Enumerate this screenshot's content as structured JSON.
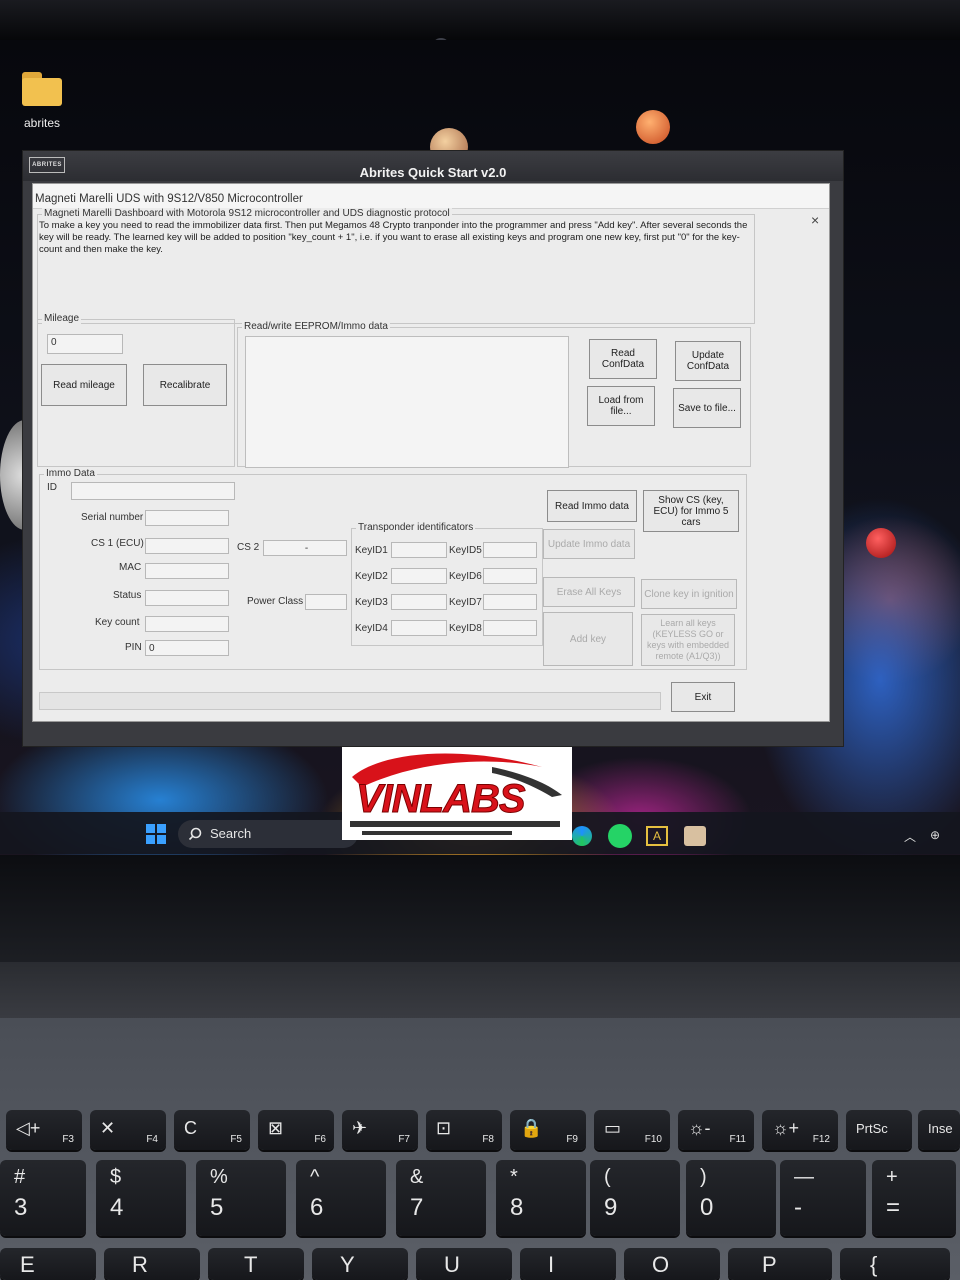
{
  "desktop": {
    "folder_label": "abrites"
  },
  "app": {
    "logo_text": "ABRITES",
    "title": "Abrites Quick Start v2.0",
    "controls": [
      "–",
      "▫",
      "×"
    ]
  },
  "dialog": {
    "title": "Magneti Marelli UDS with 9S12/V850 Microcontroller",
    "close": "×",
    "desc_group": "Magneti Marelli Dashboard with Motorola 9S12 microcontroller and UDS diagnostic protocol",
    "description": "To make a key you need to read the immobilizer data first. Then put Megamos 48 Crypto tranponder into the programmer and press \"Add key\". After several seconds the key will be ready. The learned key will be added to position \"key_count + 1\", i.e. if you want to erase all existing keys and program one new key, first put \"0\" for the key-count and then make the key.",
    "mileage": {
      "group": "Mileage",
      "value": "0",
      "read_btn": "Read mileage",
      "recalibrate_btn": "Recalibrate"
    },
    "eeprom": {
      "group": "Read/write EEPROM/Immo data",
      "read_conf": "Read ConfData",
      "update_conf": "Update ConfData",
      "load": "Load from file...",
      "save": "Save to file..."
    },
    "immo": {
      "group": "Immo Data",
      "id_label": "ID",
      "serial_label": "Serial number",
      "cs1_label": "CS 1 (ECU)",
      "mac_label": "MAC",
      "status_label": "Status",
      "keycount_label": "Key count",
      "pin_label": "PIN",
      "pin_value": "0",
      "cs2_label": "CS 2",
      "cs2_value": "-",
      "power_label": "Power Class",
      "transponder_group": "Transponder identificators",
      "keys": [
        "KeyID1",
        "KeyID2",
        "KeyID3",
        "KeyID4",
        "KeyID5",
        "KeyID6",
        "KeyID7",
        "KeyID8"
      ],
      "read_immo": "Read Immo data",
      "show_cs": "Show CS (key, ECU) for Immo 5 cars",
      "update_immo": "Update Immo data",
      "erase_keys": "Erase All Keys",
      "clone_key": "Clone key in ignition",
      "add_key": "Add key",
      "learn_keys": "Learn all keys (KEYLESS GO or keys with embedded remote (A1/Q3))"
    },
    "exit_btn": "Exit"
  },
  "taskbar": {
    "search": "Search"
  },
  "watermark": {
    "text": "VINLABS"
  },
  "keyboard": {
    "fkeys": [
      {
        "main": "◁+",
        "sub": "F3"
      },
      {
        "main": "✕",
        "sub": "F4"
      },
      {
        "main": "C",
        "sub": "F5"
      },
      {
        "main": "⊠",
        "sub": "F6"
      },
      {
        "main": "✈",
        "sub": "F7"
      },
      {
        "main": "⊡",
        "sub": "F8"
      },
      {
        "main": "🔒",
        "sub": "F9"
      },
      {
        "main": "▭",
        "sub": "F10"
      },
      {
        "main": "☼-",
        "sub": "F11"
      },
      {
        "main": "☼+",
        "sub": "F12"
      },
      {
        "main": "PrtSc",
        "sub": ""
      },
      {
        "main": "Inse",
        "sub": ""
      }
    ],
    "nkeys": [
      {
        "top": "#",
        "bot": "3"
      },
      {
        "top": "$",
        "bot": "4"
      },
      {
        "top": "%",
        "bot": "5"
      },
      {
        "top": "^",
        "bot": "6"
      },
      {
        "top": "&",
        "bot": "7"
      },
      {
        "top": "*",
        "bot": "8"
      },
      {
        "top": "(",
        "bot": "9"
      },
      {
        "top": ")",
        "bot": "0"
      },
      {
        "top": "—",
        "bot": "-"
      },
      {
        "top": "+",
        "bot": "="
      }
    ],
    "bottom_row": [
      "E",
      "R",
      "T",
      "Y",
      "U",
      "I",
      "O",
      "P",
      "{"
    ]
  }
}
